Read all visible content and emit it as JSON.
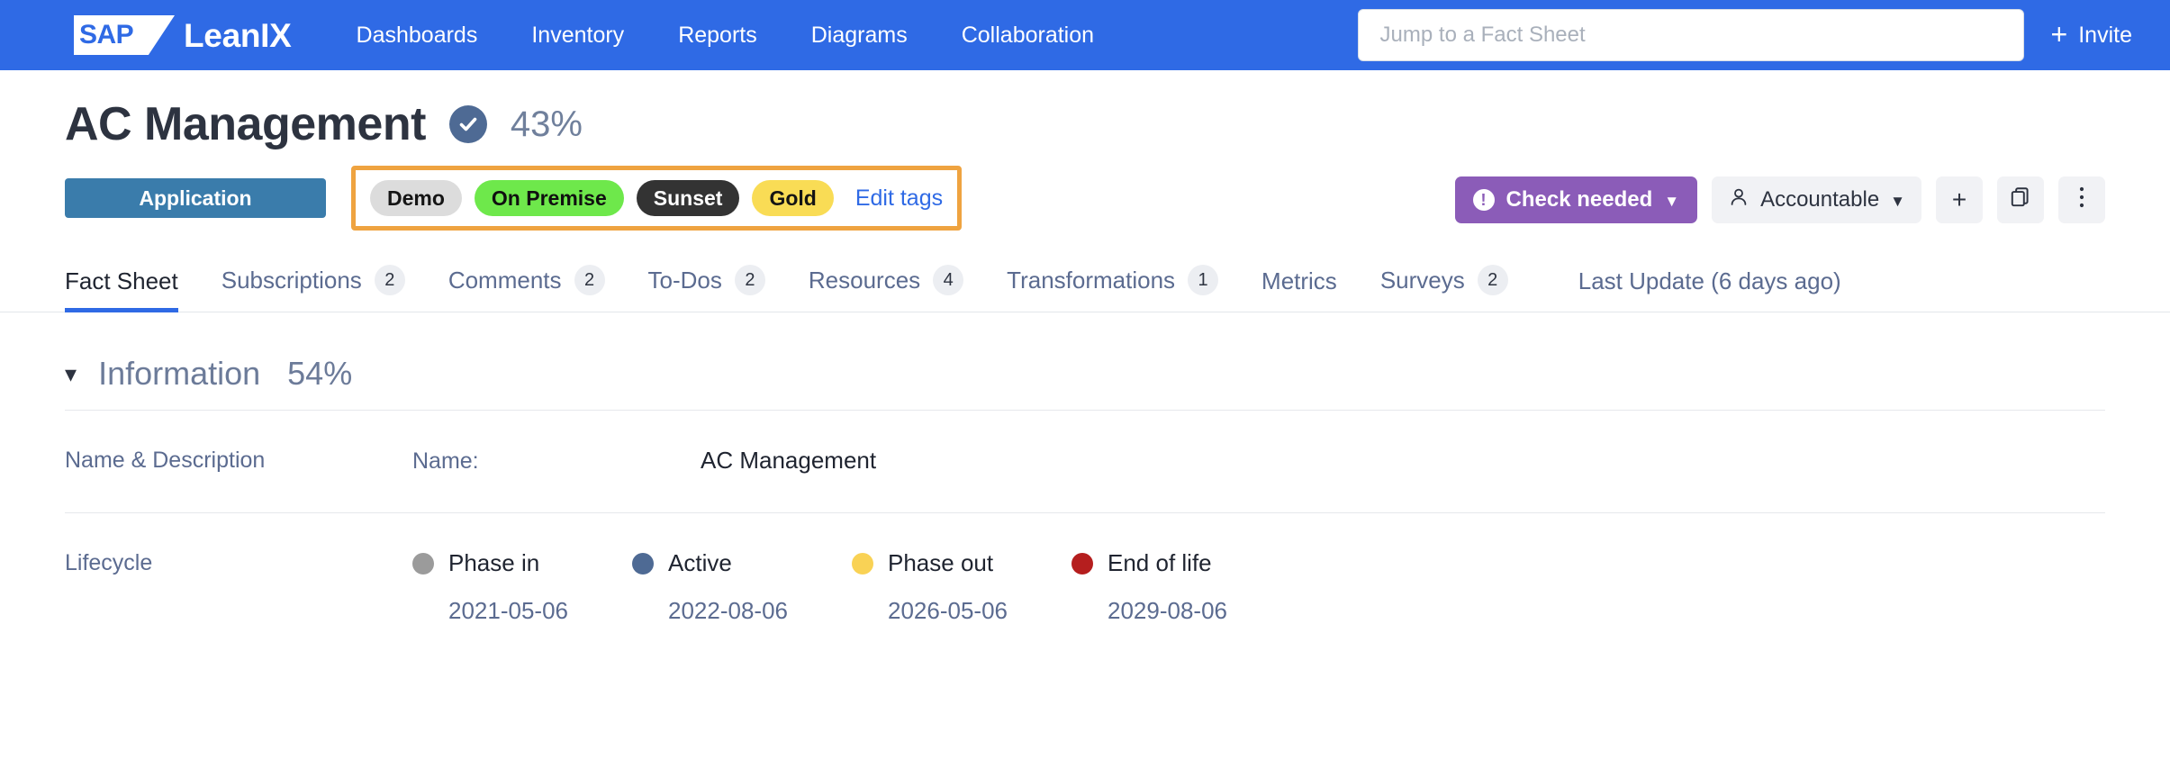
{
  "topbar": {
    "logo_text": "SAP",
    "brand_name": "LeanIX",
    "nav": [
      {
        "label": "Dashboards"
      },
      {
        "label": "Inventory"
      },
      {
        "label": "Reports"
      },
      {
        "label": "Diagrams"
      },
      {
        "label": "Collaboration"
      }
    ],
    "search": {
      "value": "",
      "placeholder": "Jump to a Fact Sheet"
    },
    "invite_label": "Invite",
    "invite_icon": "plus-icon",
    "accent_color": "#2f6ae5"
  },
  "header": {
    "title": "AC Management",
    "verified_icon": "check-circle-icon",
    "completion": "43%",
    "type_badge": "Application",
    "tags": [
      {
        "label": "Demo",
        "color": "#dcdcdc",
        "text_color": "#151515"
      },
      {
        "label": "On Premise",
        "color": "#6ee84b",
        "text_color": "#101010"
      },
      {
        "label": "Sunset",
        "color": "#333333",
        "text_color": "#ffffff"
      },
      {
        "label": "Gold",
        "color": "#f9dc55",
        "text_color": "#141414"
      }
    ],
    "edit_tags_label": "Edit tags",
    "highlight_color": "#efa340",
    "actions": {
      "check_needed_label": "Check needed",
      "check_needed_icon": "exclamation-icon",
      "check_needed_color": "#8b5cb8",
      "accountable_label": "Accountable",
      "accountable_icon": "person-icon",
      "add_icon": "plus-icon",
      "duplicate_icon": "copy-icon",
      "more_icon": "kebab-menu-icon",
      "caret_icon": "chevron-down-icon"
    }
  },
  "tabs": [
    {
      "label": "Fact Sheet",
      "count": "",
      "active": true
    },
    {
      "label": "Subscriptions",
      "count": "2",
      "active": false
    },
    {
      "label": "Comments",
      "count": "2",
      "active": false
    },
    {
      "label": "To-Dos",
      "count": "2",
      "active": false
    },
    {
      "label": "Resources",
      "count": "4",
      "active": false
    },
    {
      "label": "Transformations",
      "count": "1",
      "active": false
    },
    {
      "label": "Metrics",
      "count": "",
      "active": false
    },
    {
      "label": "Surveys",
      "count": "2",
      "active": false
    },
    {
      "label": "Last Update (6 days ago)",
      "count": "",
      "active": false
    }
  ],
  "information": {
    "section_title": "Information",
    "section_pct": "54%",
    "collapse_icon": "chevron-down-icon",
    "name_description": {
      "label": "Name & Description",
      "sub_label": "Name:",
      "value": "AC Management"
    },
    "lifecycle": {
      "label": "Lifecycle",
      "phases": [
        {
          "name": "Phase in",
          "date": "2021-05-06",
          "color": "#9b9b9b"
        },
        {
          "name": "Active",
          "date": "2022-08-06",
          "color": "#4e6a94"
        },
        {
          "name": "Phase out",
          "date": "2026-05-06",
          "color": "#f9d255"
        },
        {
          "name": "End of life",
          "date": "2029-08-06",
          "color": "#b51e1e"
        }
      ]
    }
  }
}
